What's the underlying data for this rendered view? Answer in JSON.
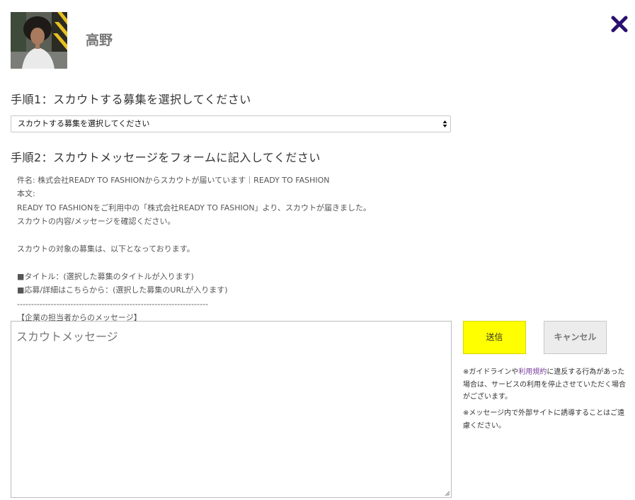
{
  "profile": {
    "name": "高野",
    "avatar_icon": "user-photo"
  },
  "close_icon": "close-x-icon",
  "accent_color": "#2a1070",
  "step1": {
    "title": "手順1：スカウトする募集を選択してください",
    "select_value": "スカウトする募集を選択してください"
  },
  "step2": {
    "title": "手順2：スカウトメッセージをフォームに記入してください"
  },
  "template": {
    "lines": [
      "件名: 株式会社READY TO FASHIONからスカウトが届いています｜READY TO FASHION",
      "本文:",
      "READY TO FASHIONをご利用中の「株式会社READY TO FASHION」より、スカウトが届きました。",
      "スカウトの内容/メッセージを確認ください。",
      "",
      "スカウトの対象の募集は、以下となっております。",
      "",
      "■タイトル：(選択した募集のタイトルが入ります)",
      "■応募/詳細はこちらから：(選択した募集のURLが入ります)",
      "--------------------------------------------------------------------",
      "【企業の担当者からのメッセージ】"
    ]
  },
  "message": {
    "placeholder": "スカウトメッセージ"
  },
  "buttons": {
    "send": "送信",
    "cancel": "キャンセル",
    "send_color": "#ffff00"
  },
  "notices": {
    "n1_pre": "※ガイドラインや",
    "n1_link": "利用規約",
    "n1_post": "に違反する行為があった場合は、サービスの利用を停止させていただく場合がございます。",
    "n2": "※メッセージ内で外部サイトに誘導することはご遠慮ください。"
  }
}
